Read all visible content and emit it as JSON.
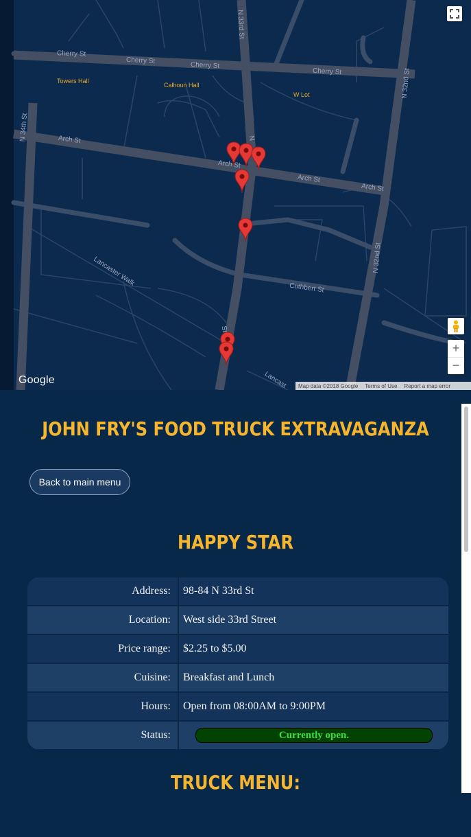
{
  "map": {
    "streets": [
      "Cherry St",
      "Cherry St",
      "Cherry St",
      "Cherry St",
      "N 33rd St",
      "N 34th St",
      "N 32nd St",
      "N 32nd St",
      "Arch St",
      "Arch St",
      "Arch St",
      "Arch St",
      "Lancaster Walk",
      "Cuthbert St",
      "Lancast",
      "St",
      "N"
    ],
    "pois": [
      "Towers Hall",
      "Calhoun Hall",
      "W Lot"
    ],
    "logo": "Google",
    "footer": {
      "data": "Map data ©2018 Google",
      "terms": "Terms of Use",
      "report": "Report a map error"
    },
    "controls": {
      "fullscreen_icon": "fullscreen-icon",
      "pegman_icon": "pegman-icon",
      "zoom_in": "+",
      "zoom_out": "−"
    },
    "marker_color": "#e53935",
    "marker_count": 8
  },
  "page": {
    "title": "JOHN FRY'S FOOD TRUCK EXTRAVAGANZA",
    "back_button": "Back to main menu",
    "truck_name": "HAPPY STAR",
    "details": [
      {
        "label": "Address:",
        "value": "98-84 N 33rd St"
      },
      {
        "label": "Location:",
        "value": "West side 33rd Street"
      },
      {
        "label": "Price range:",
        "value": "$2.25 to $5.00"
      },
      {
        "label": "Cuisine:",
        "value": "Breakfast and Lunch"
      },
      {
        "label": "Hours:",
        "value": "Open from 08:00AM to 9:00PM"
      },
      {
        "label": "Status:",
        "value": "Currently open."
      }
    ],
    "menu_heading": "TRUCK MENU:"
  },
  "colors": {
    "accent": "#f5b52e",
    "background": "#08284a",
    "status_open": "#3ddc3d"
  }
}
